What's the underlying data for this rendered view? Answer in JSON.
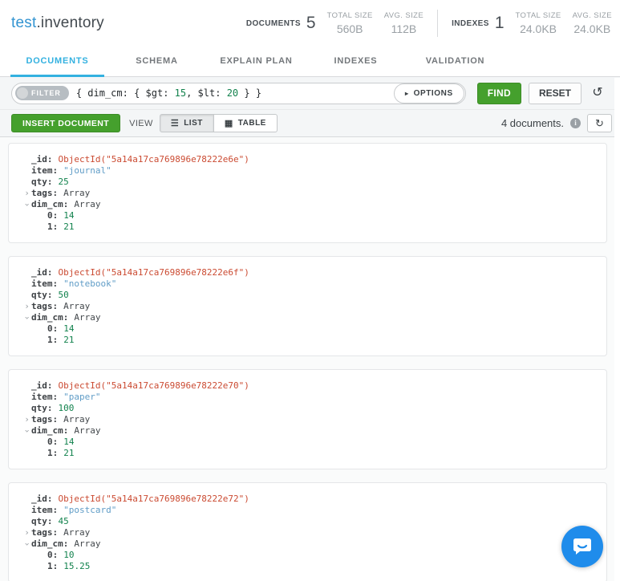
{
  "header": {
    "namespace": {
      "db": "test",
      "rest": ".inventory"
    },
    "stats": {
      "documents_label": "DOCUMENTS",
      "documents_count": "5",
      "doc_total_size_label": "TOTAL SIZE",
      "doc_total_size": "560B",
      "doc_avg_size_label": "AVG. SIZE",
      "doc_avg_size": "112B",
      "indexes_label": "INDEXES",
      "indexes_count": "1",
      "idx_total_size_label": "TOTAL SIZE",
      "idx_total_size": "24.0KB",
      "idx_avg_size_label": "AVG. SIZE",
      "idx_avg_size": "24.0KB"
    }
  },
  "tabs": [
    {
      "label": "DOCUMENTS",
      "active": true
    },
    {
      "label": "SCHEMA",
      "active": false
    },
    {
      "label": "EXPLAIN PLAN",
      "active": false
    },
    {
      "label": "INDEXES",
      "active": false
    },
    {
      "label": "VALIDATION",
      "active": false
    }
  ],
  "query_bar": {
    "filter_label": "FILTER",
    "query": {
      "prefix": "{ dim_cm: { $gt: ",
      "num1": "15",
      "mid": ", $lt: ",
      "num2": "20",
      "suffix": " } }"
    },
    "options_label": "OPTIONS",
    "find_label": "FIND",
    "reset_label": "RESET"
  },
  "action_bar": {
    "insert_label": "INSERT DOCUMENT",
    "view_label": "VIEW",
    "list_label": "LIST",
    "table_label": "TABLE",
    "count_text": "4 documents."
  },
  "icons": {
    "options_caret": "▸",
    "history": "↺",
    "refresh": "↻",
    "list_view": "☰",
    "table_view": "▦",
    "info": "i",
    "doc_caret": "›",
    "filter_dot": "●"
  },
  "colors": {
    "tab_active_blue": "#33b1e0",
    "button_green": "#45a02d",
    "db_link_blue": "#3394d1",
    "objectid_red": "#cb4b32",
    "string_blue": "#609dc7",
    "number_green": "#12824d",
    "intercom_blue": "#1f8ceb"
  },
  "documents": [
    {
      "lines": [
        {
          "indent": 1,
          "expand": null,
          "key": "_id",
          "value": "ObjectId(\"5a14a17ca769896e78222e6e\")",
          "type": "objectid"
        },
        {
          "indent": 1,
          "expand": null,
          "key": "item",
          "value": "\"journal\"",
          "type": "string"
        },
        {
          "indent": 1,
          "expand": null,
          "key": "qty",
          "value": "25",
          "type": "number"
        },
        {
          "indent": 1,
          "expand": "collapsed",
          "key": "tags",
          "value": "Array",
          "type": "array"
        },
        {
          "indent": 1,
          "expand": "expanded",
          "key": "dim_cm",
          "value": "Array",
          "type": "array"
        },
        {
          "indent": 2,
          "expand": null,
          "key": "0",
          "value": "14",
          "type": "number"
        },
        {
          "indent": 2,
          "expand": null,
          "key": "1",
          "value": "21",
          "type": "number"
        }
      ]
    },
    {
      "lines": [
        {
          "indent": 1,
          "expand": null,
          "key": "_id",
          "value": "ObjectId(\"5a14a17ca769896e78222e6f\")",
          "type": "objectid"
        },
        {
          "indent": 1,
          "expand": null,
          "key": "item",
          "value": "\"notebook\"",
          "type": "string"
        },
        {
          "indent": 1,
          "expand": null,
          "key": "qty",
          "value": "50",
          "type": "number"
        },
        {
          "indent": 1,
          "expand": "collapsed",
          "key": "tags",
          "value": "Array",
          "type": "array"
        },
        {
          "indent": 1,
          "expand": "expanded",
          "key": "dim_cm",
          "value": "Array",
          "type": "array"
        },
        {
          "indent": 2,
          "expand": null,
          "key": "0",
          "value": "14",
          "type": "number"
        },
        {
          "indent": 2,
          "expand": null,
          "key": "1",
          "value": "21",
          "type": "number"
        }
      ]
    },
    {
      "lines": [
        {
          "indent": 1,
          "expand": null,
          "key": "_id",
          "value": "ObjectId(\"5a14a17ca769896e78222e70\")",
          "type": "objectid"
        },
        {
          "indent": 1,
          "expand": null,
          "key": "item",
          "value": "\"paper\"",
          "type": "string"
        },
        {
          "indent": 1,
          "expand": null,
          "key": "qty",
          "value": "100",
          "type": "number"
        },
        {
          "indent": 1,
          "expand": "collapsed",
          "key": "tags",
          "value": "Array",
          "type": "array"
        },
        {
          "indent": 1,
          "expand": "expanded",
          "key": "dim_cm",
          "value": "Array",
          "type": "array"
        },
        {
          "indent": 2,
          "expand": null,
          "key": "0",
          "value": "14",
          "type": "number"
        },
        {
          "indent": 2,
          "expand": null,
          "key": "1",
          "value": "21",
          "type": "number"
        }
      ]
    },
    {
      "lines": [
        {
          "indent": 1,
          "expand": null,
          "key": "_id",
          "value": "ObjectId(\"5a14a17ca769896e78222e72\")",
          "type": "objectid"
        },
        {
          "indent": 1,
          "expand": null,
          "key": "item",
          "value": "\"postcard\"",
          "type": "string"
        },
        {
          "indent": 1,
          "expand": null,
          "key": "qty",
          "value": "45",
          "type": "number"
        },
        {
          "indent": 1,
          "expand": "collapsed",
          "key": "tags",
          "value": "Array",
          "type": "array"
        },
        {
          "indent": 1,
          "expand": "expanded",
          "key": "dim_cm",
          "value": "Array",
          "type": "array"
        },
        {
          "indent": 2,
          "expand": null,
          "key": "0",
          "value": "10",
          "type": "number"
        },
        {
          "indent": 2,
          "expand": null,
          "key": "1",
          "value": "15.25",
          "type": "number"
        }
      ]
    }
  ]
}
